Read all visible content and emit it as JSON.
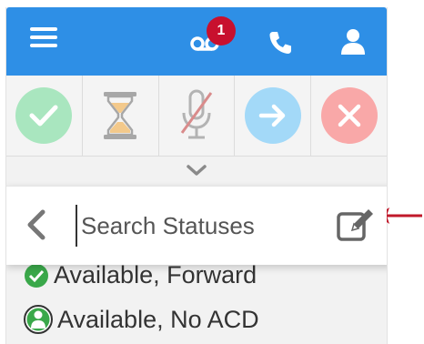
{
  "topbar": {
    "menu_icon": "hamburger-icon",
    "voicemail_icon": "voicemail-icon",
    "voicemail_badge": "1",
    "phone_icon": "phone-icon",
    "user_icon": "user-icon",
    "color": "#2e8fe6",
    "badge_color": "#c8102e"
  },
  "status_buttons": [
    {
      "icon": "check-circle-icon",
      "color": "#a9e6bf"
    },
    {
      "icon": "hourglass-icon",
      "color": "#f3c98b"
    },
    {
      "icon": "microphone-muted-icon",
      "color": "#d98b8b"
    },
    {
      "icon": "arrow-right-circle-icon",
      "color": "#a3d9f8"
    },
    {
      "icon": "close-circle-icon",
      "color": "#f9a8a8"
    }
  ],
  "expand_icon": "chevron-down-icon",
  "search": {
    "placeholder": "Search Statuses",
    "back_icon": "chevron-left-icon",
    "edit_icon": "edit-icon"
  },
  "statuses": [
    {
      "label": "Available, Forward",
      "icon": "available-forward-icon"
    },
    {
      "label": "Available, No ACD",
      "icon": "available-no-acd-icon"
    }
  ],
  "annotation": {
    "icon": "red-arrow-icon",
    "color": "#c0182a"
  }
}
